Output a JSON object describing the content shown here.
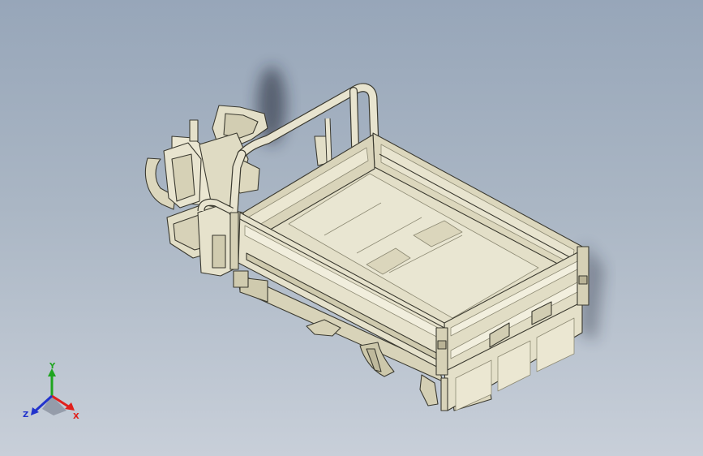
{
  "viewport": {
    "background_top": "#97a6b9",
    "background_bottom": "#c8cfd9",
    "model": "tricycle-cargo-bed-assembly",
    "model_color": "#e6e2cc",
    "edge_color": "#3b3a30"
  },
  "triad": {
    "x_label": "X",
    "y_label": "Y",
    "z_label": "Z",
    "x_color": "#e0201c",
    "y_color": "#1fa51f",
    "z_color": "#2233cc"
  }
}
